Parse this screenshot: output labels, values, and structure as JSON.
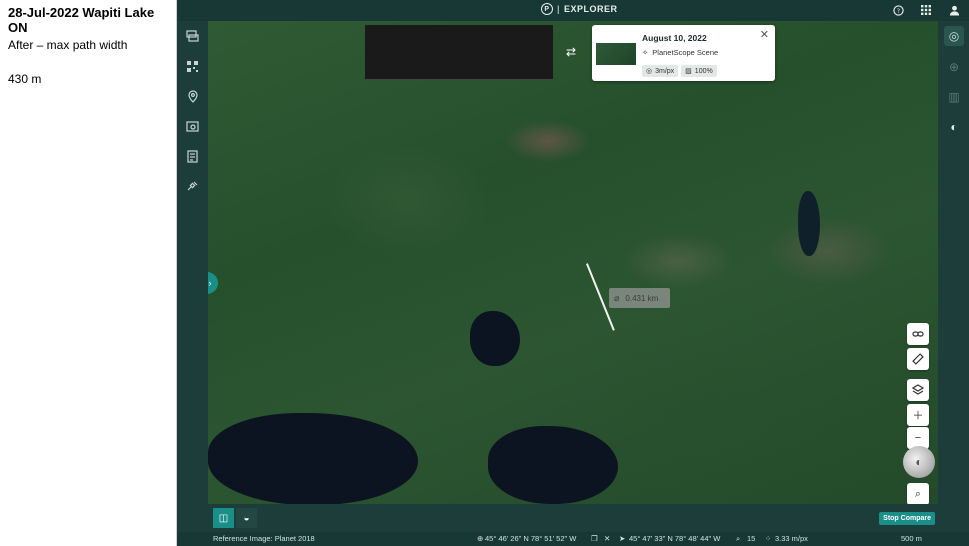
{
  "notes": {
    "title": "28-Jul-2022 Wapiti Lake ON",
    "line1": "After – max path width",
    "line2": "430 m"
  },
  "topbar": {
    "logo_letter": "P",
    "brand": "EXPLORER",
    "separator": "|"
  },
  "map": {
    "measurement_label": "0.431 km"
  },
  "scene_card": {
    "date": "August 10, 2022",
    "source": "PlanetScope Scene",
    "resolution": "3m/px",
    "coverage": "100%"
  },
  "bottom": {
    "stop_compare": "Stop Compare",
    "reference": "Reference Image: Planet 2018",
    "coord1": "45° 46' 26\" N 78° 51' 52\" W",
    "coord2": "45° 47' 33\" N 78° 48' 44\" W",
    "zoom": "15",
    "resolution": "3.33 m/px",
    "scale": "500 m"
  },
  "icons": {
    "help": "help-circle-icon",
    "apps": "grid-icon",
    "user": "user-icon"
  }
}
